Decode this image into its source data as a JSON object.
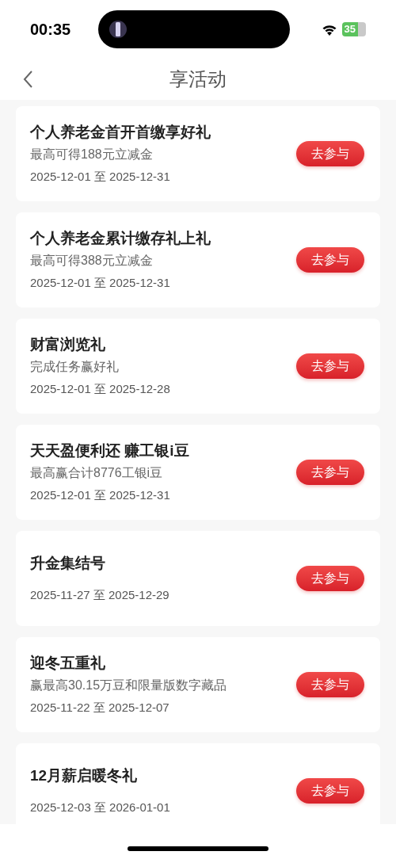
{
  "status_bar": {
    "time": "00:35",
    "battery": "35"
  },
  "nav": {
    "title": "享活动"
  },
  "activities": [
    {
      "title": "个人养老金首开首缴享好礼",
      "subtitle": "最高可得188元立减金",
      "dates": "2025-12-01 至 2025-12-31",
      "button": "去参与"
    },
    {
      "title": "个人养老金累计缴存礼上礼",
      "subtitle": "最高可得388元立减金",
      "dates": "2025-12-01 至 2025-12-31",
      "button": "去参与"
    },
    {
      "title": "财富浏览礼",
      "subtitle": "完成任务赢好礼",
      "dates": "2025-12-01 至 2025-12-28",
      "button": "去参与"
    },
    {
      "title": "天天盈便利还 赚工银i豆",
      "subtitle": "最高赢合计8776工银i豆",
      "dates": "2025-12-01 至 2025-12-31",
      "button": "去参与"
    },
    {
      "title": "升金集结号",
      "dates": "2025-11-27 至 2025-12-29",
      "button": "去参与"
    },
    {
      "title": "迎冬五重礼",
      "subtitle": "赢最高30.15万豆和限量版数字藏品",
      "dates": "2025-11-22 至 2025-12-07",
      "button": "去参与"
    },
    {
      "title": "12月薪启暖冬礼",
      "dates": "2025-12-03 至 2026-01-01",
      "button": "去参与"
    }
  ]
}
